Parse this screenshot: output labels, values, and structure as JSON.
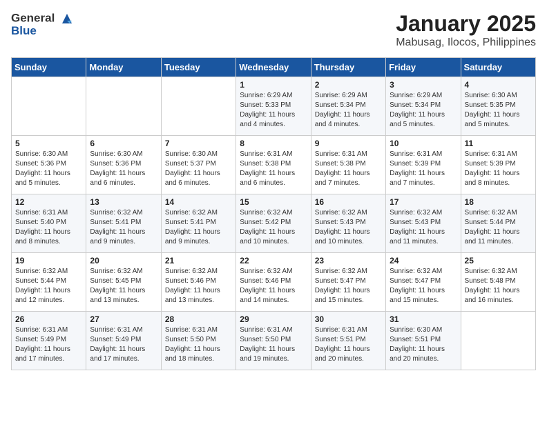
{
  "header": {
    "logo_general": "General",
    "logo_blue": "Blue",
    "title": "January 2025",
    "subtitle": "Mabusag, Ilocos, Philippines"
  },
  "weekdays": [
    "Sunday",
    "Monday",
    "Tuesday",
    "Wednesday",
    "Thursday",
    "Friday",
    "Saturday"
  ],
  "weeks": [
    [
      {
        "day": "",
        "sunrise": "",
        "sunset": "",
        "daylight": ""
      },
      {
        "day": "",
        "sunrise": "",
        "sunset": "",
        "daylight": ""
      },
      {
        "day": "",
        "sunrise": "",
        "sunset": "",
        "daylight": ""
      },
      {
        "day": "1",
        "sunrise": "Sunrise: 6:29 AM",
        "sunset": "Sunset: 5:33 PM",
        "daylight": "Daylight: 11 hours and 4 minutes."
      },
      {
        "day": "2",
        "sunrise": "Sunrise: 6:29 AM",
        "sunset": "Sunset: 5:34 PM",
        "daylight": "Daylight: 11 hours and 4 minutes."
      },
      {
        "day": "3",
        "sunrise": "Sunrise: 6:29 AM",
        "sunset": "Sunset: 5:34 PM",
        "daylight": "Daylight: 11 hours and 5 minutes."
      },
      {
        "day": "4",
        "sunrise": "Sunrise: 6:30 AM",
        "sunset": "Sunset: 5:35 PM",
        "daylight": "Daylight: 11 hours and 5 minutes."
      }
    ],
    [
      {
        "day": "5",
        "sunrise": "Sunrise: 6:30 AM",
        "sunset": "Sunset: 5:36 PM",
        "daylight": "Daylight: 11 hours and 5 minutes."
      },
      {
        "day": "6",
        "sunrise": "Sunrise: 6:30 AM",
        "sunset": "Sunset: 5:36 PM",
        "daylight": "Daylight: 11 hours and 6 minutes."
      },
      {
        "day": "7",
        "sunrise": "Sunrise: 6:30 AM",
        "sunset": "Sunset: 5:37 PM",
        "daylight": "Daylight: 11 hours and 6 minutes."
      },
      {
        "day": "8",
        "sunrise": "Sunrise: 6:31 AM",
        "sunset": "Sunset: 5:38 PM",
        "daylight": "Daylight: 11 hours and 6 minutes."
      },
      {
        "day": "9",
        "sunrise": "Sunrise: 6:31 AM",
        "sunset": "Sunset: 5:38 PM",
        "daylight": "Daylight: 11 hours and 7 minutes."
      },
      {
        "day": "10",
        "sunrise": "Sunrise: 6:31 AM",
        "sunset": "Sunset: 5:39 PM",
        "daylight": "Daylight: 11 hours and 7 minutes."
      },
      {
        "day": "11",
        "sunrise": "Sunrise: 6:31 AM",
        "sunset": "Sunset: 5:39 PM",
        "daylight": "Daylight: 11 hours and 8 minutes."
      }
    ],
    [
      {
        "day": "12",
        "sunrise": "Sunrise: 6:31 AM",
        "sunset": "Sunset: 5:40 PM",
        "daylight": "Daylight: 11 hours and 8 minutes."
      },
      {
        "day": "13",
        "sunrise": "Sunrise: 6:32 AM",
        "sunset": "Sunset: 5:41 PM",
        "daylight": "Daylight: 11 hours and 9 minutes."
      },
      {
        "day": "14",
        "sunrise": "Sunrise: 6:32 AM",
        "sunset": "Sunset: 5:41 PM",
        "daylight": "Daylight: 11 hours and 9 minutes."
      },
      {
        "day": "15",
        "sunrise": "Sunrise: 6:32 AM",
        "sunset": "Sunset: 5:42 PM",
        "daylight": "Daylight: 11 hours and 10 minutes."
      },
      {
        "day": "16",
        "sunrise": "Sunrise: 6:32 AM",
        "sunset": "Sunset: 5:43 PM",
        "daylight": "Daylight: 11 hours and 10 minutes."
      },
      {
        "day": "17",
        "sunrise": "Sunrise: 6:32 AM",
        "sunset": "Sunset: 5:43 PM",
        "daylight": "Daylight: 11 hours and 11 minutes."
      },
      {
        "day": "18",
        "sunrise": "Sunrise: 6:32 AM",
        "sunset": "Sunset: 5:44 PM",
        "daylight": "Daylight: 11 hours and 11 minutes."
      }
    ],
    [
      {
        "day": "19",
        "sunrise": "Sunrise: 6:32 AM",
        "sunset": "Sunset: 5:44 PM",
        "daylight": "Daylight: 11 hours and 12 minutes."
      },
      {
        "day": "20",
        "sunrise": "Sunrise: 6:32 AM",
        "sunset": "Sunset: 5:45 PM",
        "daylight": "Daylight: 11 hours and 13 minutes."
      },
      {
        "day": "21",
        "sunrise": "Sunrise: 6:32 AM",
        "sunset": "Sunset: 5:46 PM",
        "daylight": "Daylight: 11 hours and 13 minutes."
      },
      {
        "day": "22",
        "sunrise": "Sunrise: 6:32 AM",
        "sunset": "Sunset: 5:46 PM",
        "daylight": "Daylight: 11 hours and 14 minutes."
      },
      {
        "day": "23",
        "sunrise": "Sunrise: 6:32 AM",
        "sunset": "Sunset: 5:47 PM",
        "daylight": "Daylight: 11 hours and 15 minutes."
      },
      {
        "day": "24",
        "sunrise": "Sunrise: 6:32 AM",
        "sunset": "Sunset: 5:47 PM",
        "daylight": "Daylight: 11 hours and 15 minutes."
      },
      {
        "day": "25",
        "sunrise": "Sunrise: 6:32 AM",
        "sunset": "Sunset: 5:48 PM",
        "daylight": "Daylight: 11 hours and 16 minutes."
      }
    ],
    [
      {
        "day": "26",
        "sunrise": "Sunrise: 6:31 AM",
        "sunset": "Sunset: 5:49 PM",
        "daylight": "Daylight: 11 hours and 17 minutes."
      },
      {
        "day": "27",
        "sunrise": "Sunrise: 6:31 AM",
        "sunset": "Sunset: 5:49 PM",
        "daylight": "Daylight: 11 hours and 17 minutes."
      },
      {
        "day": "28",
        "sunrise": "Sunrise: 6:31 AM",
        "sunset": "Sunset: 5:50 PM",
        "daylight": "Daylight: 11 hours and 18 minutes."
      },
      {
        "day": "29",
        "sunrise": "Sunrise: 6:31 AM",
        "sunset": "Sunset: 5:50 PM",
        "daylight": "Daylight: 11 hours and 19 minutes."
      },
      {
        "day": "30",
        "sunrise": "Sunrise: 6:31 AM",
        "sunset": "Sunset: 5:51 PM",
        "daylight": "Daylight: 11 hours and 20 minutes."
      },
      {
        "day": "31",
        "sunrise": "Sunrise: 6:30 AM",
        "sunset": "Sunset: 5:51 PM",
        "daylight": "Daylight: 11 hours and 20 minutes."
      },
      {
        "day": "",
        "sunrise": "",
        "sunset": "",
        "daylight": ""
      }
    ]
  ]
}
